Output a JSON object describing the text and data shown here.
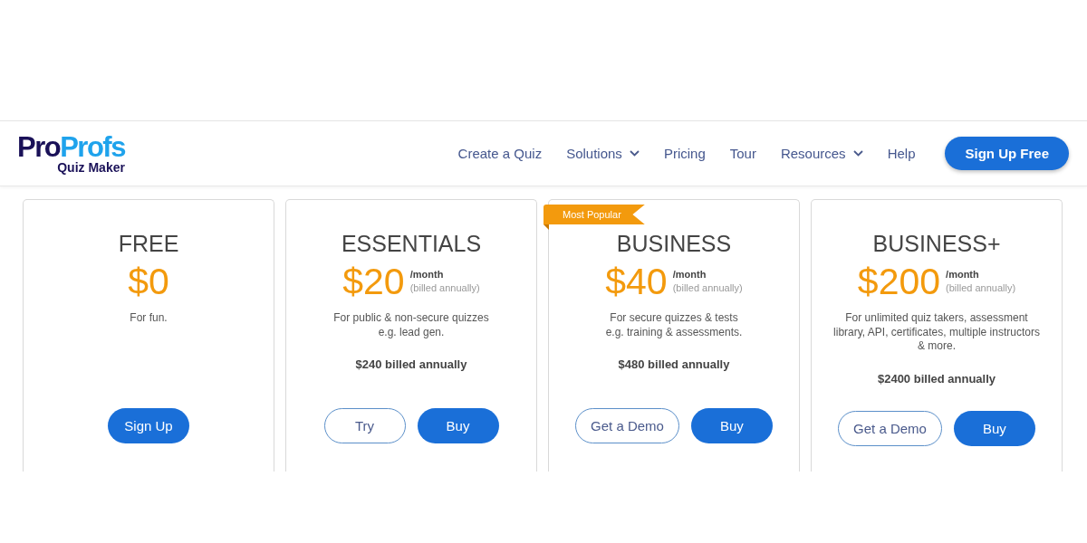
{
  "header": {
    "logo": {
      "brand_dark": "Pro",
      "brand_light": "Profs",
      "tagline": "Quiz Maker"
    },
    "nav": [
      {
        "label": "Create a Quiz",
        "dropdown": false
      },
      {
        "label": "Solutions",
        "dropdown": true
      },
      {
        "label": "Pricing",
        "dropdown": false
      },
      {
        "label": "Tour",
        "dropdown": false
      },
      {
        "label": "Resources",
        "dropdown": true
      },
      {
        "label": "Help",
        "dropdown": false
      }
    ],
    "cta": "Sign Up Free"
  },
  "plans": [
    {
      "name": "FREE",
      "price": "$0",
      "description": "For fun.",
      "buttons": [
        {
          "label": "Sign Up",
          "kind": "filled"
        }
      ]
    },
    {
      "name": "ESSENTIALS",
      "price": "$20",
      "period": "/month",
      "billing_note": "(billed annually)",
      "description": "For public & non-secure quizzes\ne.g. lead gen.",
      "annual_total": "$240 billed annually",
      "buttons": [
        {
          "label": "Try",
          "kind": "outline"
        },
        {
          "label": "Buy",
          "kind": "filled"
        }
      ]
    },
    {
      "name": "BUSINESS",
      "badge": "Most Popular",
      "price": "$40",
      "period": "/month",
      "billing_note": "(billed annually)",
      "description": "For secure quizzes & tests\ne.g. training & assessments.",
      "annual_total": "$480 billed annually",
      "buttons": [
        {
          "label": "Get a Demo",
          "kind": "outline"
        },
        {
          "label": "Buy",
          "kind": "filled"
        }
      ]
    },
    {
      "name": "BUSINESS+",
      "price": "$200",
      "period": "/month",
      "billing_note": "(billed annually)",
      "description": "For unlimited quiz takers, assessment\nlibrary, API, certificates, multiple instructors\n& more.",
      "annual_total": "$2400 billed annually",
      "buttons": [
        {
          "label": "Get a Demo",
          "kind": "outline"
        },
        {
          "label": "Buy",
          "kind": "filled"
        }
      ]
    }
  ]
}
